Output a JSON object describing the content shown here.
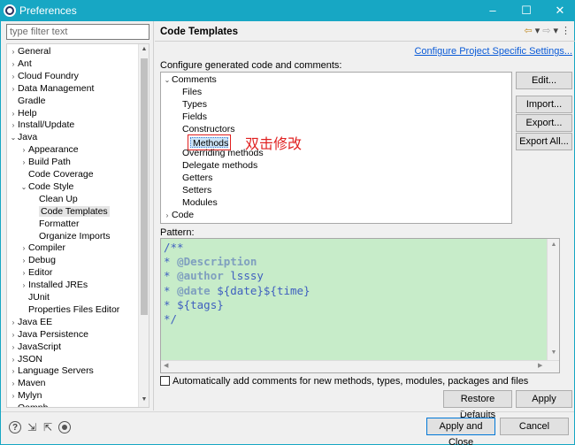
{
  "window": {
    "title": "Preferences",
    "controls": {
      "minimize": "–",
      "maximize": "☐",
      "close": "✕"
    }
  },
  "filter": {
    "placeholder": "type filter text"
  },
  "left_tree": [
    {
      "label": "General",
      "depth": 0,
      "twisty": "›"
    },
    {
      "label": "Ant",
      "depth": 0,
      "twisty": "›"
    },
    {
      "label": "Cloud Foundry",
      "depth": 0,
      "twisty": "›"
    },
    {
      "label": "Data Management",
      "depth": 0,
      "twisty": "›"
    },
    {
      "label": "Gradle",
      "depth": 0,
      "twisty": ""
    },
    {
      "label": "Help",
      "depth": 0,
      "twisty": "›"
    },
    {
      "label": "Install/Update",
      "depth": 0,
      "twisty": "›"
    },
    {
      "label": "Java",
      "depth": 0,
      "twisty": "⌄"
    },
    {
      "label": "Appearance",
      "depth": 1,
      "twisty": "›"
    },
    {
      "label": "Build Path",
      "depth": 1,
      "twisty": "›"
    },
    {
      "label": "Code Coverage",
      "depth": 1,
      "twisty": ""
    },
    {
      "label": "Code Style",
      "depth": 1,
      "twisty": "⌄"
    },
    {
      "label": "Clean Up",
      "depth": 2,
      "twisty": ""
    },
    {
      "label": "Code Templates",
      "depth": 2,
      "twisty": "",
      "selected": true
    },
    {
      "label": "Formatter",
      "depth": 2,
      "twisty": ""
    },
    {
      "label": "Organize Imports",
      "depth": 2,
      "twisty": ""
    },
    {
      "label": "Compiler",
      "depth": 1,
      "twisty": "›"
    },
    {
      "label": "Debug",
      "depth": 1,
      "twisty": "›"
    },
    {
      "label": "Editor",
      "depth": 1,
      "twisty": "›"
    },
    {
      "label": "Installed JREs",
      "depth": 1,
      "twisty": "›"
    },
    {
      "label": "JUnit",
      "depth": 1,
      "twisty": ""
    },
    {
      "label": "Properties Files Editor",
      "depth": 1,
      "twisty": ""
    },
    {
      "label": "Java EE",
      "depth": 0,
      "twisty": "›"
    },
    {
      "label": "Java Persistence",
      "depth": 0,
      "twisty": "›"
    },
    {
      "label": "JavaScript",
      "depth": 0,
      "twisty": "›"
    },
    {
      "label": "JSON",
      "depth": 0,
      "twisty": "›"
    },
    {
      "label": "Language Servers",
      "depth": 0,
      "twisty": "›"
    },
    {
      "label": "Maven",
      "depth": 0,
      "twisty": "›"
    },
    {
      "label": "Mylyn",
      "depth": 0,
      "twisty": "›"
    },
    {
      "label": "Oomph",
      "depth": 0,
      "twisty": "›"
    }
  ],
  "page": {
    "title": "Code Templates",
    "nav_icons": [
      "⇦",
      "▾",
      "⇨",
      "▾",
      "⋮"
    ],
    "config_link": "Configure Project Specific Settings...",
    "config_label": "Configure generated code and comments:",
    "annotation": "双击修改",
    "pattern_label": "Pattern:",
    "auto_comments_label": "Automatically add comments for new methods, types, modules, packages and files"
  },
  "template_tree": [
    {
      "label": "Comments",
      "depth": 0,
      "twisty": "⌄"
    },
    {
      "label": "Files",
      "depth": 1
    },
    {
      "label": "Types",
      "depth": 1
    },
    {
      "label": "Fields",
      "depth": 1
    },
    {
      "label": "Constructors",
      "depth": 1
    },
    {
      "label": "Methods",
      "depth": 1,
      "selected": true
    },
    {
      "label": "Overriding methods",
      "depth": 1
    },
    {
      "label": "Delegate methods",
      "depth": 1
    },
    {
      "label": "Getters",
      "depth": 1
    },
    {
      "label": "Setters",
      "depth": 1
    },
    {
      "label": "Modules",
      "depth": 1
    },
    {
      "label": "Code",
      "depth": 0,
      "twisty": "›"
    }
  ],
  "side_buttons": {
    "edit": "Edit...",
    "import": "Import...",
    "export": "Export...",
    "export_all": "Export All..."
  },
  "pattern_lines": [
    [
      {
        "text": "/**",
        "cls": "c"
      }
    ],
    [
      {
        "text": "* ",
        "cls": "c"
      },
      {
        "text": "@Description",
        "cls": "t"
      }
    ],
    [
      {
        "text": "* ",
        "cls": "c"
      },
      {
        "text": "@author",
        "cls": "t"
      },
      {
        "text": " lsssy",
        "cls": "c"
      }
    ],
    [
      {
        "text": "* ",
        "cls": "c"
      },
      {
        "text": "@date",
        "cls": "t"
      },
      {
        "text": " ${date}${time}",
        "cls": "v"
      }
    ],
    [
      {
        "text": "* ",
        "cls": "c"
      },
      {
        "text": "${tags}",
        "cls": "v"
      }
    ],
    [
      {
        "text": "*/",
        "cls": "c"
      }
    ]
  ],
  "action_buttons": {
    "restore_defaults": "Restore Defaults",
    "apply": "Apply"
  },
  "dialog_buttons": {
    "apply_close": "Apply and Close",
    "cancel": "Cancel"
  },
  "bottom_icons": [
    "help-icon",
    "import-prefs-icon",
    "export-prefs-icon",
    "record-icon"
  ]
}
